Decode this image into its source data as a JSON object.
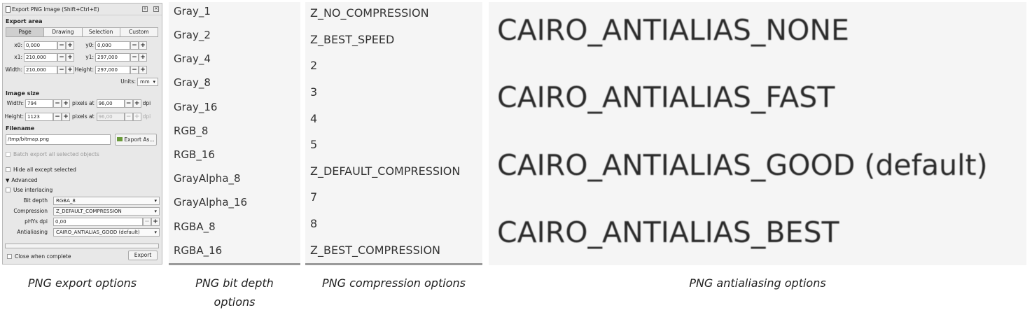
{
  "dialog": {
    "title": "Export PNG Image (Shift+Ctrl+E)",
    "export_area": {
      "heading": "Export area",
      "modes": [
        "Page",
        "Drawing",
        "Selection",
        "Custom"
      ],
      "active_mode": "Page",
      "x0_label": "x0:",
      "x0": "0,000",
      "y0_label": "y0:",
      "y0": "0,000",
      "x1_label": "x1:",
      "x1": "210,000",
      "y1_label": "y1:",
      "y1": "297,000",
      "width_label": "Width:",
      "width": "210,000",
      "height_label": "Height:",
      "height": "297,000",
      "units_label": "Units:",
      "units": "mm"
    },
    "image_size": {
      "heading": "Image size",
      "width_label": "Width:",
      "width": "794",
      "height_label": "Height:",
      "height": "1123",
      "pixels_at": "pixels at",
      "dpi_value": "96,00",
      "dpi_value_2": "96,00",
      "dpi_unit": "dpi"
    },
    "filename": {
      "heading": "Filename",
      "path": "/tmp/bitmap.png",
      "export_as_label": "Export As..."
    },
    "batch_label": "Batch export all selected objects",
    "hide_label": "Hide all except selected",
    "advanced_label": "Advanced",
    "interlacing_label": "Use interlacing",
    "bit_depth_label": "Bit depth",
    "bit_depth": "RGBA_8",
    "compression_label": "Compression",
    "compression": "Z_DEFAULT_COMPRESSION",
    "phys_label": "pHYs dpi",
    "phys": "0,00",
    "antialiasing_label": "Antialiasing",
    "antialiasing": "CAIRO_ANTIALIAS_GOOD (default)",
    "close_label": "Close when complete",
    "export_label": "Export"
  },
  "bit_depth_options": [
    "Gray_1",
    "Gray_2",
    "Gray_4",
    "Gray_8",
    "Gray_16",
    "RGB_8",
    "RGB_16",
    "GrayAlpha_8",
    "GrayAlpha_16",
    "RGBA_8",
    "RGBA_16"
  ],
  "compression_options": [
    "Z_NO_COMPRESSION",
    "Z_BEST_SPEED",
    "2",
    "3",
    "4",
    "5",
    "Z_DEFAULT_COMPRESSION",
    "7",
    "8",
    "Z_BEST_COMPRESSION"
  ],
  "antialias_options": [
    "CAIRO_ANTIALIAS_NONE",
    "CAIRO_ANTIALIAS_FAST",
    "CAIRO_ANTIALIAS_GOOD (default)",
    "CAIRO_ANTIALIAS_BEST"
  ],
  "captions": {
    "export": "PNG export options",
    "bit_depth_1": "PNG bit depth",
    "bit_depth_2": "options",
    "compression": "PNG compression options",
    "antialias": "PNG antialiasing options"
  }
}
